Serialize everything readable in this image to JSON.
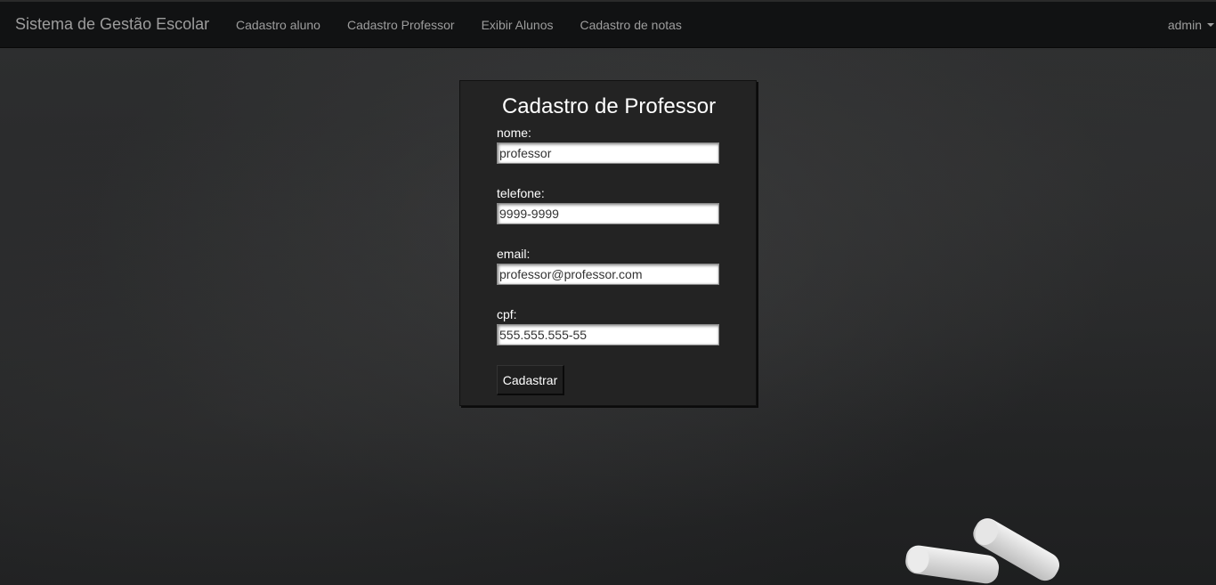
{
  "navbar": {
    "brand": "Sistema de Gestão Escolar",
    "links": [
      {
        "label": "Cadastro aluno"
      },
      {
        "label": "Cadastro Professor"
      },
      {
        "label": "Exibir Alunos"
      },
      {
        "label": "Cadastro de notas"
      }
    ],
    "user": "admin",
    "user_icon": "caret-down-icon"
  },
  "form": {
    "title": "Cadastro de Professor",
    "fields": [
      {
        "label": "nome:",
        "value": "professor"
      },
      {
        "label": "telefone:",
        "value": "9999-9999"
      },
      {
        "label": "email:",
        "value": "professor@professor.com"
      },
      {
        "label": "cpf:",
        "value": "555.555.555-55"
      }
    ],
    "submit_label": "Cadastrar"
  },
  "colors": {
    "navbar_bg": "#111213",
    "nav_text": "#9d9d9d",
    "panel_bg": "#232323",
    "background": "#2a2b2c"
  }
}
